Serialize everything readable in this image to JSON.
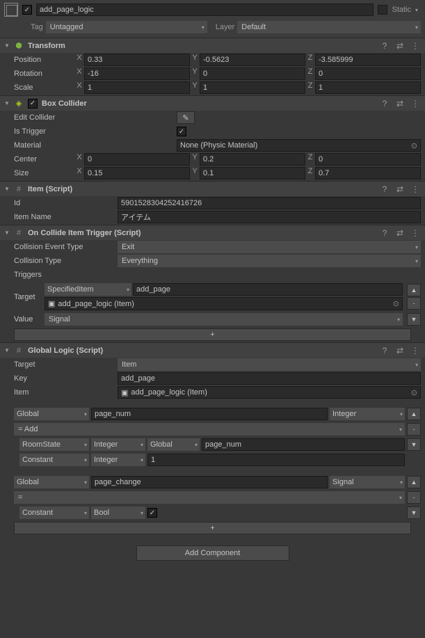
{
  "header": {
    "name": "add_page_logic",
    "enabled": true,
    "static_label": "Static",
    "tag_label": "Tag",
    "tag_value": "Untagged",
    "layer_label": "Layer",
    "layer_value": "Default"
  },
  "transform": {
    "title": "Transform",
    "position": {
      "label": "Position",
      "x": "0.33",
      "y": "-0.5623",
      "z": "-3.585999"
    },
    "rotation": {
      "label": "Rotation",
      "x": "-16",
      "y": "0",
      "z": "0"
    },
    "scale": {
      "label": "Scale",
      "x": "1",
      "y": "1",
      "z": "1"
    }
  },
  "box_collider": {
    "title": "Box Collider",
    "enabled": true,
    "edit_collider": "Edit Collider",
    "is_trigger": {
      "label": "Is Trigger",
      "value": true
    },
    "material": {
      "label": "Material",
      "value": "None (Physic Material)"
    },
    "center": {
      "label": "Center",
      "x": "0",
      "y": "0.2",
      "z": "0"
    },
    "size": {
      "label": "Size",
      "x": "0.15",
      "y": "0.1",
      "z": "0.7"
    }
  },
  "item_script": {
    "title": "Item (Script)",
    "id": {
      "label": "Id",
      "value": "5901528304252416726"
    },
    "item_name": {
      "label": "Item Name",
      "value": "アイテム"
    }
  },
  "collide_trigger": {
    "title": "On Collide Item Trigger (Script)",
    "collision_event_type": {
      "label": "Collision Event Type",
      "value": "Exit"
    },
    "collision_type": {
      "label": "Collision Type",
      "value": "Everything"
    },
    "triggers_label": "Triggers",
    "target_label": "Target",
    "target_type": "SpecifiedItem",
    "target_name": "add_page",
    "target_ref": "add_page_logic (Item)",
    "value_label": "Value",
    "value_type": "Signal"
  },
  "global_logic": {
    "title": "Global Logic (Script)",
    "target": {
      "label": "Target",
      "value": "Item"
    },
    "key": {
      "label": "Key",
      "value": "add_page"
    },
    "item": {
      "label": "Item",
      "value": "add_page_logic (Item)"
    },
    "ops": [
      {
        "scope": "Global",
        "var_name": "page_num",
        "var_type": "Integer",
        "op": "= Add",
        "terms": [
          {
            "source": "RoomState",
            "type": "Integer",
            "scope2": "Global",
            "name": "page_num"
          },
          {
            "source": "Constant",
            "type": "Integer",
            "value": "1"
          }
        ]
      },
      {
        "scope": "Global",
        "var_name": "page_change",
        "var_type": "Signal",
        "op": "=",
        "terms": [
          {
            "source": "Constant",
            "type": "Bool",
            "value": true
          }
        ]
      }
    ]
  },
  "add_component": "Add Component",
  "add_label": "+"
}
